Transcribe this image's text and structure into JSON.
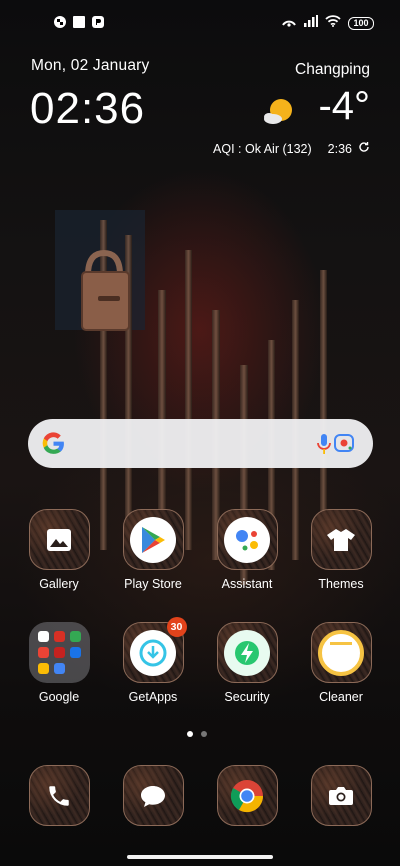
{
  "status_bar": {
    "battery": "100",
    "left_icons": [
      "notification-icon",
      "square-icon",
      "app-notification-icon"
    ],
    "right_icons": [
      "hotspot-icon",
      "signal-icon",
      "wifi-icon",
      "battery-icon"
    ]
  },
  "clock_widget": {
    "date": "Mon, 02 January",
    "time": "02:36",
    "city": "Changping",
    "temperature": "-4°",
    "aqi": "AQI : Ok Air (132)",
    "updated": "2:36",
    "weather_icon": "partly-cloudy-icon"
  },
  "search_bar": {
    "icons": [
      "google-logo-icon",
      "microphone-icon",
      "lens-icon"
    ]
  },
  "apps_row1": [
    {
      "label": "Gallery",
      "icon": "gallery-icon"
    },
    {
      "label": "Play Store",
      "icon": "play-store-icon"
    },
    {
      "label": "Assistant",
      "icon": "assistant-icon"
    },
    {
      "label": "Themes",
      "icon": "themes-icon"
    }
  ],
  "apps_row2": [
    {
      "label": "Google",
      "icon": "folder-icon"
    },
    {
      "label": "GetApps",
      "icon": "getapps-icon",
      "badge": "30"
    },
    {
      "label": "Security",
      "icon": "security-icon"
    },
    {
      "label": "Cleaner",
      "icon": "cleaner-icon"
    }
  ],
  "dock": [
    {
      "icon": "phone-icon"
    },
    {
      "icon": "messages-icon"
    },
    {
      "icon": "chrome-icon"
    },
    {
      "icon": "camera-icon"
    }
  ],
  "page_indicator": {
    "pages": 2,
    "current": 1
  },
  "colors": {
    "badge": "#e2431b",
    "icon_border": "#8c6a58",
    "search_bg": "#f0f0f2"
  }
}
